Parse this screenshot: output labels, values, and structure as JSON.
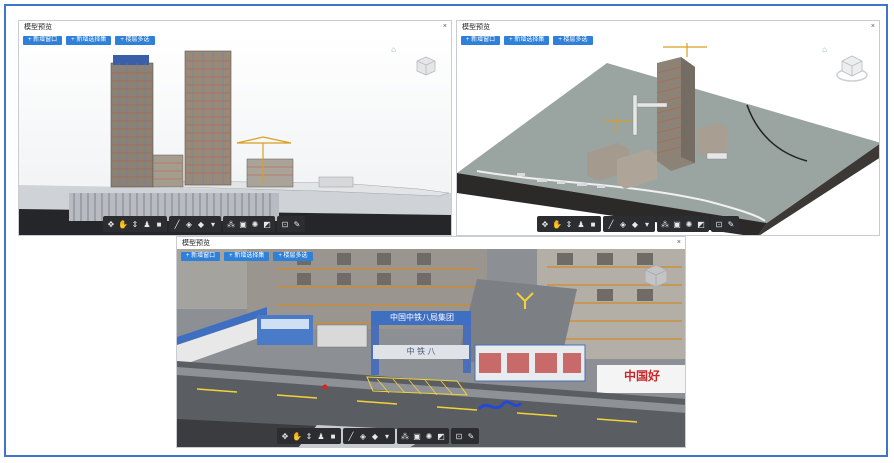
{
  "panels": [
    {
      "title": "模型预览",
      "close": "×",
      "buttons": [
        "+ 新增窗口",
        "+ 新增选择集",
        "+ 楼层多选"
      ]
    },
    {
      "title": "模型预览",
      "close": "×",
      "buttons": [
        "+ 新增窗口",
        "+ 新增选择集",
        "+ 楼层多选"
      ]
    },
    {
      "title": "模型预览",
      "close": "×",
      "buttons": [
        "+ 新增窗口",
        "+ 新增选择集",
        "+ 楼层多选"
      ]
    }
  ],
  "scene_text": {
    "gate_sign": "中国中铁八局集团",
    "gate_lower": "中 铁 八",
    "hoarding": "中国好"
  },
  "toolbar_icons": [
    "rotate-icon",
    "hand-icon",
    "zoom-icon",
    "walk-icon",
    "camera-icon",
    "measure-icon",
    "section-icon",
    "layers-icon",
    "views-icon",
    "tree-icon",
    "properties-icon",
    "settings-icon",
    "fullscreen-icon",
    "screenshot-icon",
    "pin-icon"
  ],
  "colors": {
    "accent": "#2f80d8",
    "frame": "#3f74c9",
    "toolbar": "#2b2d31",
    "active": "#3b9bff"
  }
}
